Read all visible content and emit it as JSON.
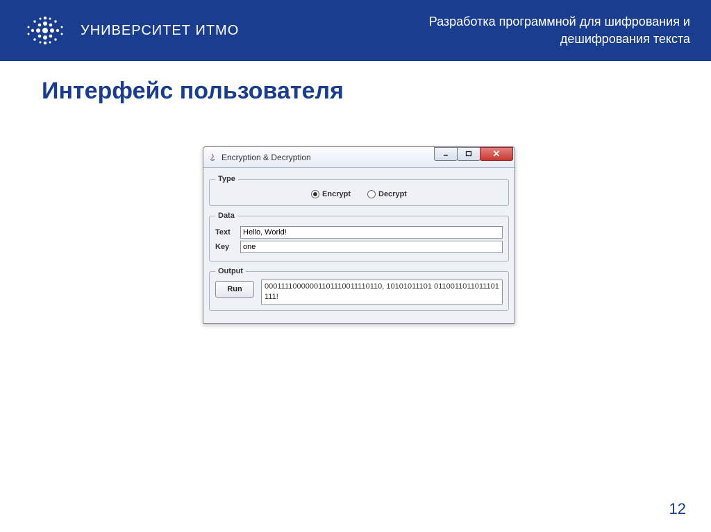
{
  "header": {
    "university": "УНИВЕРСИТЕТ ИТМО",
    "subtitle_line1": "Разработка программной для шифрования и",
    "subtitle_line2": "дешифрования текста"
  },
  "slide": {
    "title": "Интерфейс пользователя",
    "page_number": "12"
  },
  "app": {
    "window_title": "Encryption & Decryption",
    "group_type": "Type",
    "group_data": "Data",
    "group_output": "Output",
    "radio_encrypt": "Encrypt",
    "radio_decrypt": "Decrypt",
    "label_text": "Text",
    "label_key": "Key",
    "value_text": "Hello, World!",
    "value_key": "one",
    "run_label": "Run",
    "output_value": "00011110000001101110011110110, 10101011101 0110011011011101111!"
  }
}
